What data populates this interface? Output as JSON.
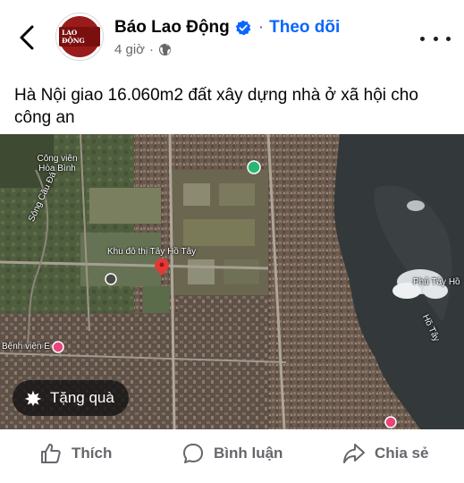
{
  "header": {
    "page_name": "Báo Lao Động",
    "follow_label": "Theo dõi",
    "dot": "·",
    "time": "4 giờ",
    "avatar_text": "LAO ĐỘNG"
  },
  "post": {
    "caption": "Hà Nội giao 16.060m2 đất xây dựng nhà ở xã hội cho công an"
  },
  "map": {
    "labels": {
      "park": "Công viên Hòa Bình",
      "river": "Sông Cầu Đá",
      "urban": "Khu đô thị Tây Hồ Tây",
      "phu_tay_ho": "Phủ Tây Hồ",
      "lake": "Hồ Tây",
      "hospital": "Bệnh viện E"
    }
  },
  "gift": {
    "label": "Tặng quà"
  },
  "actions": {
    "like": "Thích",
    "comment": "Bình luận",
    "share": "Chia sẻ"
  },
  "colors": {
    "accent": "#0866ff",
    "secondary_text": "#65676b",
    "avatar_red": "#9a1b1b"
  },
  "icons": [
    "back-arrow-icon",
    "verified-badge-icon",
    "globe-icon",
    "more-icon",
    "gift-icon",
    "like-icon",
    "comment-icon",
    "share-icon",
    "map-pin-icon"
  ]
}
